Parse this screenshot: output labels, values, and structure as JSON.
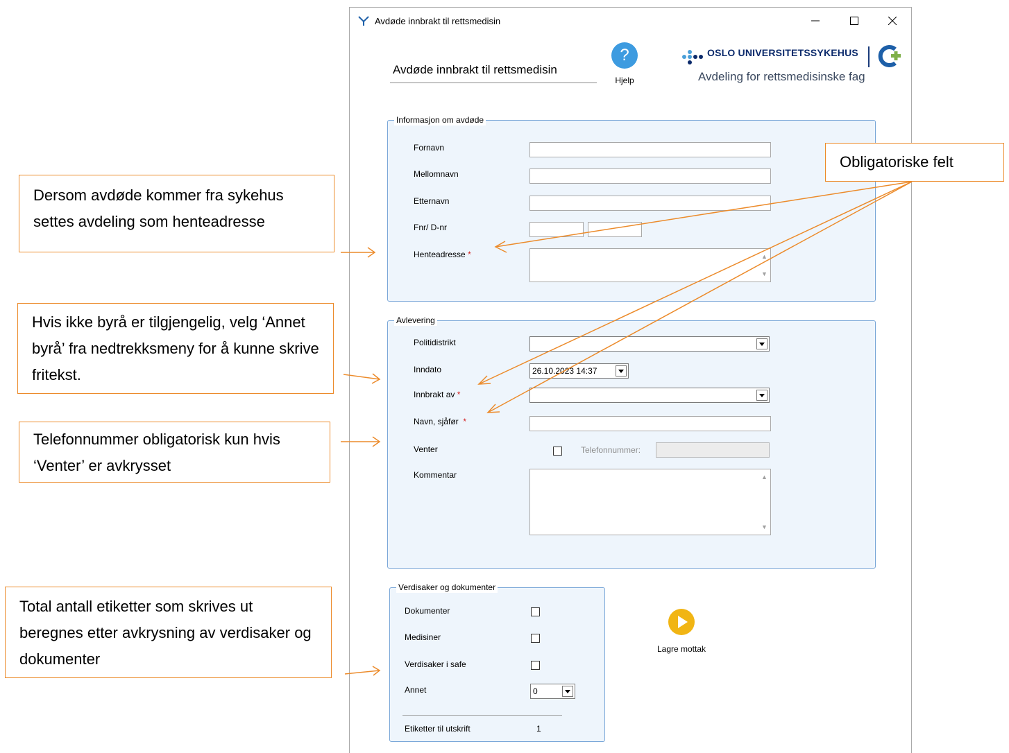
{
  "window": {
    "title": "Avdøde innbrakt til rettsmedisin",
    "controls": [
      "minimize",
      "maximize",
      "close"
    ]
  },
  "header": {
    "form_title": "Avdøde innbrakt til rettsmedisin",
    "help_label": "Hjelp",
    "logo_name": "OSLO UNIVERSITETSSYKEHUS",
    "logo_department": "Avdeling for rettsmedisinske fag"
  },
  "info_group": {
    "title": "Informasjon om avdøde",
    "fields": {
      "fornavn_label": "Fornavn",
      "fornavn_value": "",
      "mellomnavn_label": "Mellomnavn",
      "mellomnavn_value": "",
      "etternavn_label": "Etternavn",
      "etternavn_value": "",
      "fnr_label": "Fnr/ D-nr",
      "fnr_value": "",
      "dnr_value": "",
      "henteadresse_label": "Henteadresse",
      "henteadresse_value": ""
    },
    "required_marker": "*"
  },
  "delivery_group": {
    "title": "Avlevering",
    "politidistrikt_label": "Politidistrikt",
    "politidistrikt_value": "",
    "inndato_label": "Inndato",
    "inndato_value": "26.10.2023 14:37",
    "innbrakt_av_label": "Innbrakt av",
    "innbrakt_av_value": "",
    "navn_sjafor_label": "Navn, sjåfør",
    "navn_sjafor_value": "",
    "venter_label": "Venter",
    "venter_checked": false,
    "telefonnummer_label": "Telefonnummer:",
    "telefonnummer_value": "",
    "kommentar_label": "Kommentar",
    "kommentar_value": ""
  },
  "valuables_group": {
    "title": "Verdisaker og dokumenter",
    "dokumenter_label": "Dokumenter",
    "dokumenter_checked": false,
    "medisiner_label": "Medisiner",
    "medisiner_checked": false,
    "verdisaker_label": "Verdisaker i safe",
    "verdisaker_checked": false,
    "annet_label": "Annet",
    "annet_value": "0",
    "etiketter_label": "Etiketter til utskrift",
    "etiketter_value": "1"
  },
  "actions": {
    "save_label": "Lagre mottak"
  },
  "callouts": {
    "obligatoriske": "Obligatoriske felt",
    "sykehus": "Dersom avdøde kommer fra sykehus settes avdeling som henteadresse",
    "byra": "Hvis ikke byrå er tilgjengelig, velg ‘Annet byrå’ fra nedtrekksmeny for å kunne skrive fritekst.",
    "telefon": "Telefonnummer obligatorisk kun hvis ‘Venter’ er avkrysset",
    "etiketter": "Total antall etiketter som skrives ut beregnes etter avkrysning av verdisaker og dokumenter"
  },
  "colors": {
    "callout_border": "#ec8b2b",
    "group_background": "#eef5fc",
    "group_border": "#7aa7d8",
    "required_marker": "#d41c1c",
    "help_icon": "#3d9be0",
    "save_icon": "#f1b514",
    "logo_text": "#0b2a6b"
  },
  "icons": {
    "app": "app-logo-icon",
    "help": "question-mark-icon",
    "save": "play-icon",
    "minimize": "minimize-icon",
    "maximize": "maximize-icon",
    "close": "close-icon"
  }
}
